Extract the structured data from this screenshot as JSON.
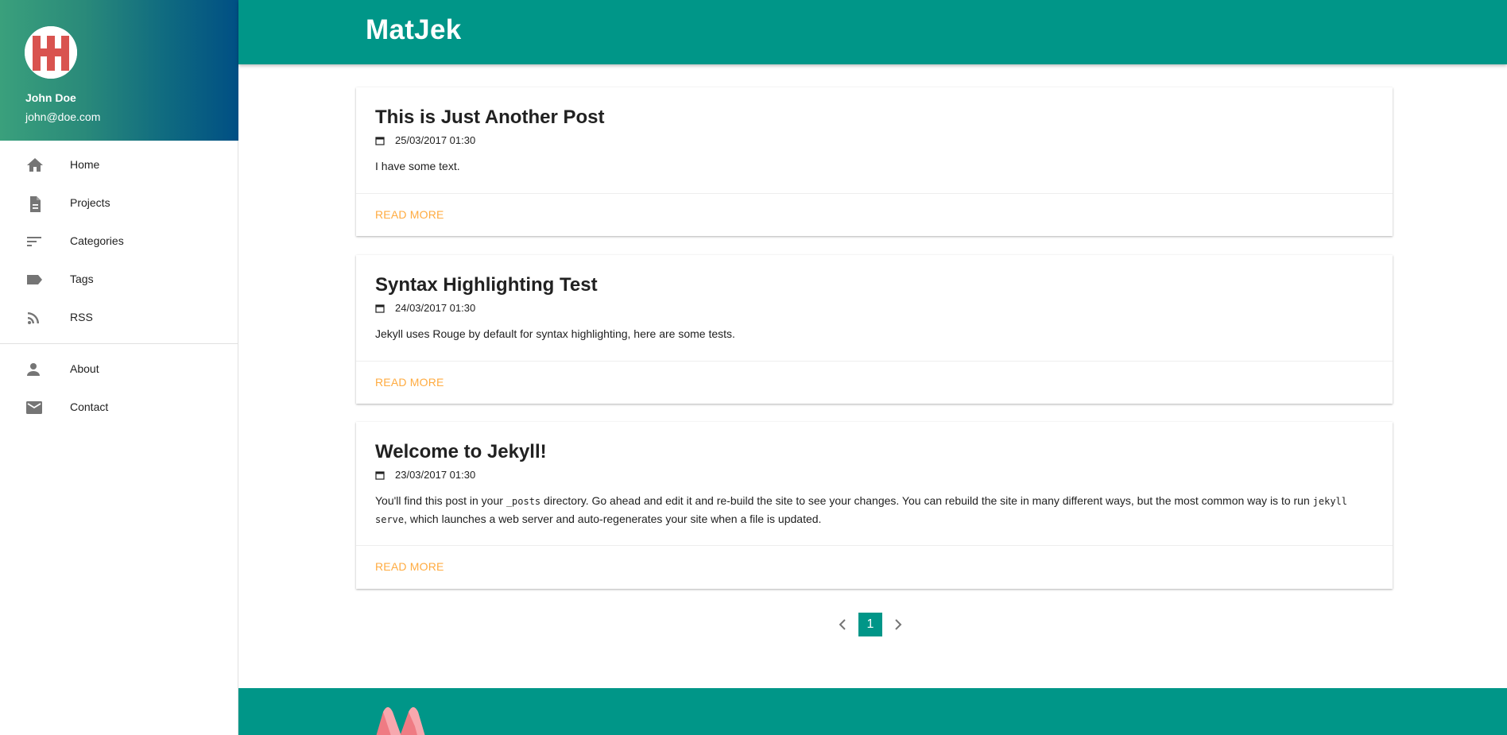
{
  "user": {
    "name": "John Doe",
    "email": "john@doe.com"
  },
  "site": {
    "title": "MatJek"
  },
  "nav": {
    "primary": [
      {
        "label": "Home",
        "icon": "home-icon"
      },
      {
        "label": "Projects",
        "icon": "document-icon"
      },
      {
        "label": "Categories",
        "icon": "sort-icon"
      },
      {
        "label": "Tags",
        "icon": "label-icon"
      },
      {
        "label": "RSS",
        "icon": "rss-icon"
      }
    ],
    "secondary": [
      {
        "label": "About",
        "icon": "person-icon"
      },
      {
        "label": "Contact",
        "icon": "mail-icon"
      }
    ]
  },
  "posts": [
    {
      "title": "This is Just Another Post",
      "date": "25/03/2017 01:30",
      "excerpt": "I have some text.",
      "read_more": "READ MORE"
    },
    {
      "title": "Syntax Highlighting Test",
      "date": "24/03/2017 01:30",
      "excerpt": "Jekyll uses Rouge by default for syntax highlighting, here are some tests.",
      "read_more": "READ MORE"
    },
    {
      "title": "Welcome to Jekyll!",
      "date": "23/03/2017 01:30",
      "excerpt_parts": {
        "a": "You'll find this post in your ",
        "code1": "_posts",
        "b": " directory. Go ahead and edit it and re-build the site to see your changes. You can rebuild the site in many different ways, but the most common way is to run ",
        "code2": "jekyll serve",
        "c": ", which launches a web server and auto-regenerates your site when a file is updated."
      },
      "read_more": "READ MORE"
    }
  ],
  "pagination": {
    "current": "1"
  },
  "colors": {
    "primary": "#009688",
    "accent": "#ffab40"
  }
}
